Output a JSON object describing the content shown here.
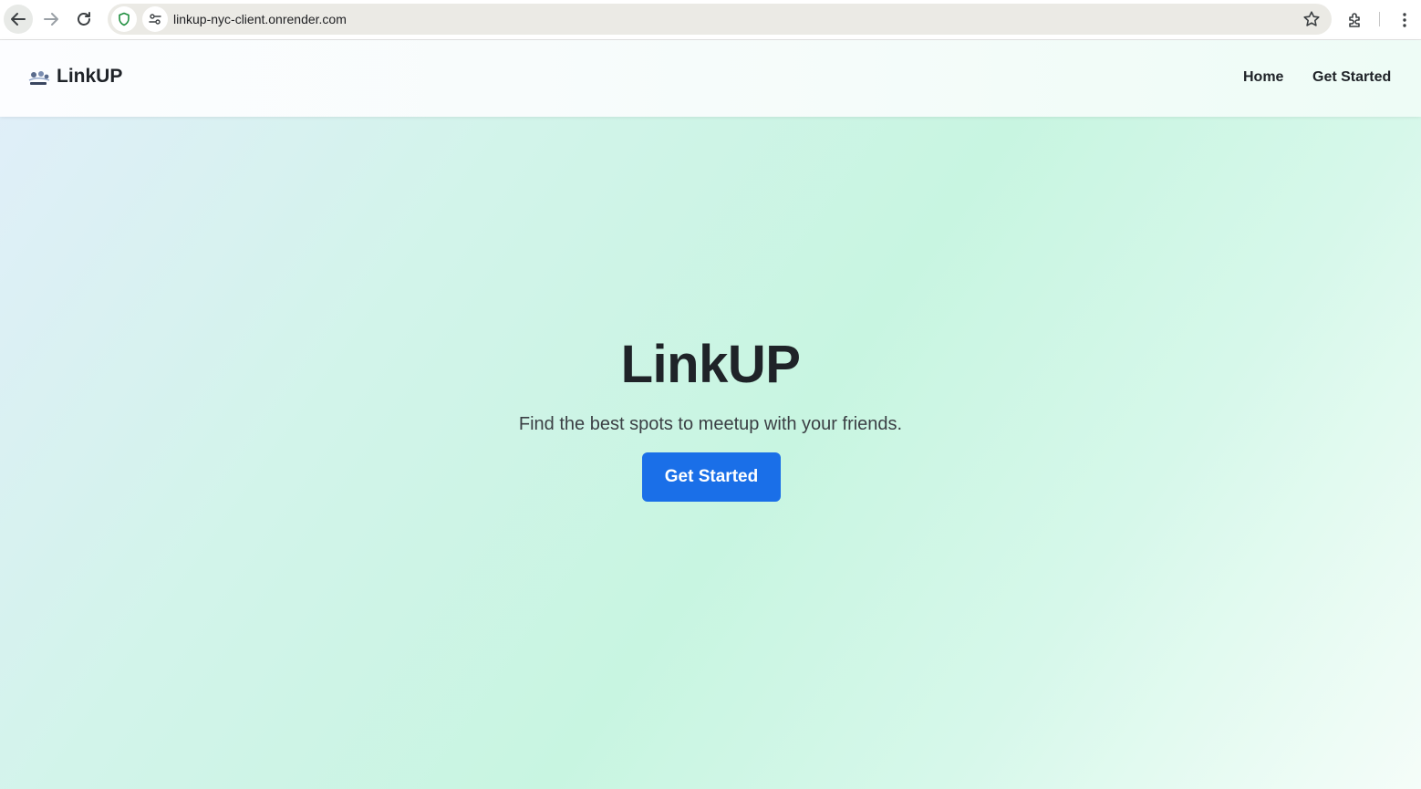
{
  "browser": {
    "url": "linkup-nyc-client.onrender.com"
  },
  "header": {
    "brand_name": "LinkUP",
    "nav": [
      {
        "label": "Home"
      },
      {
        "label": "Get Started"
      }
    ]
  },
  "hero": {
    "title": "LinkUP",
    "subtitle": "Find the best spots to meetup with your friends.",
    "cta_label": "Get Started"
  },
  "colors": {
    "cta_bg": "#1a6fe8",
    "text_dark": "#1f2328",
    "gradient_mint": "#c8f5e1"
  },
  "icons": [
    "back-arrow-icon",
    "forward-arrow-icon",
    "reload-icon",
    "shield-icon",
    "site-settings-icon",
    "star-icon",
    "extensions-icon",
    "kebab-menu-icon",
    "brand-logo-icon"
  ]
}
